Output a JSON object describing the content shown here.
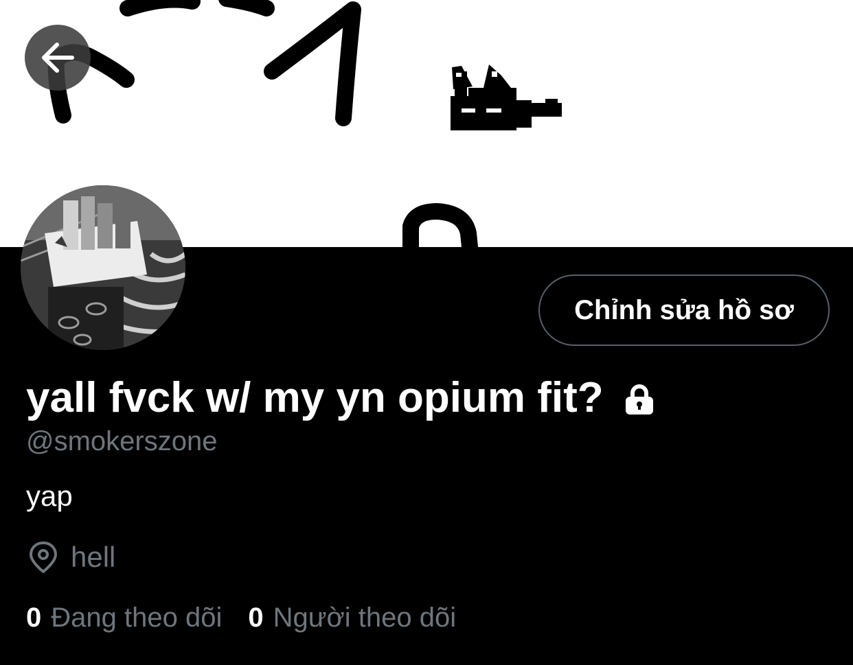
{
  "header": {
    "back_icon": "arrow-left-icon"
  },
  "profile": {
    "display_name": "yall fvck w/ my yn opium fit?",
    "protected_icon": "lock-icon",
    "handle": "@smokerszone",
    "bio": "yap",
    "location_icon": "map-pin-icon",
    "location": "hell",
    "edit_button_label": "Chỉnh sửa hồ sơ"
  },
  "stats": {
    "following": {
      "count": "0",
      "label": "Đang theo dõi"
    },
    "followers": {
      "count": "0",
      "label": "Người theo dõi"
    }
  },
  "colors": {
    "background": "#000000",
    "banner": "#ffffff",
    "primary_text": "#ffffff",
    "secondary_text": "#6e767d",
    "button_border": "#56606b"
  }
}
